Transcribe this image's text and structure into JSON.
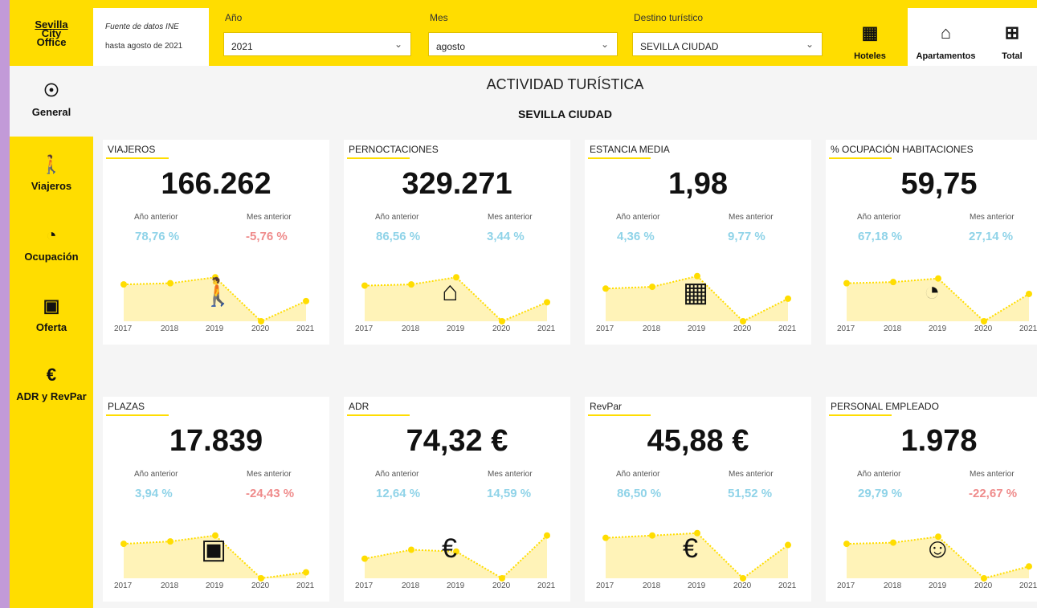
{
  "logo": {
    "line1": "Sevilla",
    "line2": "City",
    "line3": "Office"
  },
  "source": {
    "line1": "Fuente de datos INE",
    "line2": "hasta  agosto de 2021"
  },
  "filters": {
    "year": {
      "label": "Año",
      "value": "2021"
    },
    "month": {
      "label": "Mes",
      "value": "agosto"
    },
    "destination": {
      "label": "Destino turístico",
      "value": "SEVILLA CIUDAD"
    }
  },
  "types": [
    {
      "label": "Hoteles",
      "icon": "building-icon"
    },
    {
      "label": "Apartamentos",
      "icon": "apartment-icon"
    },
    {
      "label": "Total",
      "icon": "calculator-icon"
    }
  ],
  "sidebar": [
    {
      "label": "General",
      "icon": "map-pin-icon"
    },
    {
      "label": "Viajeros",
      "icon": "traveler-icon"
    },
    {
      "label": "Ocupación",
      "icon": "gauge-icon"
    },
    {
      "label": "Oferta",
      "icon": "bed-icon"
    },
    {
      "label": "ADR y RevPar",
      "icon": "euro-icon"
    }
  ],
  "header": {
    "title": "ACTIVIDAD TURÍSTICA",
    "subtitle": "SEVILLA CIUDAD"
  },
  "compare_labels": {
    "prev_year": "Año anterior",
    "prev_month": "Mes anterior"
  },
  "years": [
    "2017",
    "2018",
    "2019",
    "2020",
    "2021"
  ],
  "colors": {
    "accent": "#ffdd00",
    "positive": "#8fd3e8",
    "negative": "#ef8b8b"
  },
  "cards": [
    {
      "title": "VIAJEROS",
      "value": "166.262",
      "prev_year": "78,76 %",
      "prev_month": "-5,76 %",
      "prev_year_sign": "pos",
      "prev_month_sign": "neg",
      "icon": "traveler-icon",
      "trend": [
        0.62,
        0.64,
        0.74,
        0.0,
        0.34
      ]
    },
    {
      "title": "PERNOCTACIONES",
      "value": "329.271",
      "prev_year": "86,56 %",
      "prev_month": "3,44 %",
      "prev_year_sign": "pos",
      "prev_month_sign": "pos",
      "icon": "hotel-icon",
      "trend": [
        0.6,
        0.62,
        0.74,
        0.0,
        0.32
      ]
    },
    {
      "title": "ESTANCIA MEDIA",
      "value": "1,98",
      "prev_year": "4,36 %",
      "prev_month": "9,77 %",
      "prev_year_sign": "pos",
      "prev_month_sign": "pos",
      "icon": "building-icon",
      "trend": [
        0.55,
        0.58,
        0.76,
        0.0,
        0.38
      ]
    },
    {
      "title": "% OCUPACIÓN HABITACIONES",
      "value": "59,75",
      "prev_year": "67,18 %",
      "prev_month": "27,14 %",
      "prev_year_sign": "pos",
      "prev_month_sign": "pos",
      "icon": "gauge-icon",
      "trend": [
        0.64,
        0.66,
        0.72,
        0.0,
        0.46
      ]
    },
    {
      "title": "PLAZAS",
      "value": "17.839",
      "prev_year": "3,94 %",
      "prev_month": "-24,43 %",
      "prev_year_sign": "pos",
      "prev_month_sign": "neg",
      "icon": "bed-icon",
      "trend": [
        0.58,
        0.62,
        0.72,
        0.0,
        0.1
      ]
    },
    {
      "title": "ADR",
      "value": "74,32 €",
      "prev_year": "12,64 %",
      "prev_month": "14,59 %",
      "prev_year_sign": "pos",
      "prev_month_sign": "pos",
      "icon": "euro-icon",
      "trend": [
        0.33,
        0.48,
        0.45,
        0.0,
        0.72
      ]
    },
    {
      "title": "RevPar",
      "value": "45,88 €",
      "prev_year": "86,50 %",
      "prev_month": "51,52 %",
      "prev_year_sign": "pos",
      "prev_month_sign": "pos",
      "icon": "euro-icon",
      "trend": [
        0.68,
        0.72,
        0.76,
        0.0,
        0.56
      ]
    },
    {
      "title": "PERSONAL EMPLEADO",
      "value": "1.978",
      "prev_year": "29,79 %",
      "prev_month": "-22,67 %",
      "prev_year_sign": "pos",
      "prev_month_sign": "neg",
      "icon": "people-icon",
      "trend": [
        0.58,
        0.6,
        0.7,
        0.0,
        0.2
      ]
    }
  ]
}
